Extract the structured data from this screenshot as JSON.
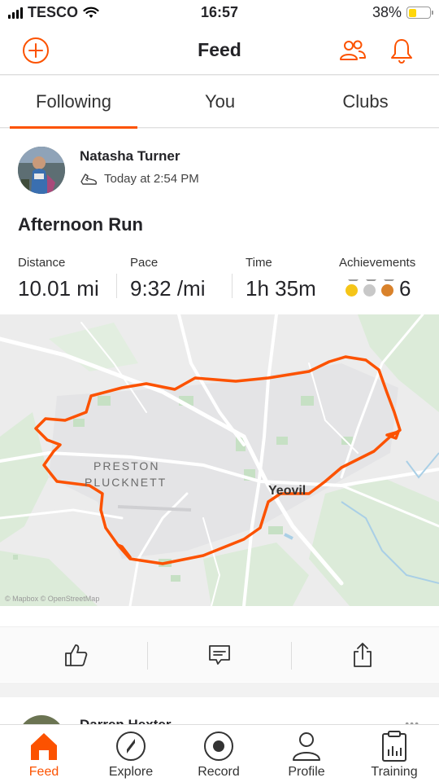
{
  "status_bar": {
    "carrier": "TESCO",
    "time": "16:57",
    "battery_percent": "38%",
    "battery_level": 0.38,
    "icons": [
      "signal-icon",
      "wifi-icon",
      "battery-icon"
    ]
  },
  "header": {
    "title": "Feed",
    "icons": [
      "add-icon",
      "people-icon",
      "bell-icon"
    ]
  },
  "tabs": [
    {
      "label": "Following",
      "active": true
    },
    {
      "label": "You",
      "active": false
    },
    {
      "label": "Clubs",
      "active": false
    }
  ],
  "activity": {
    "athlete": "Natasha Turner",
    "timestamp": "Today at 2:54 PM",
    "sport_icon": "shoe-icon",
    "title": "Afternoon Run",
    "stats": {
      "distance": {
        "label": "Distance",
        "value": "10.01 mi"
      },
      "pace": {
        "label": "Pace",
        "value": "9:32 /mi"
      },
      "time": {
        "label": "Time",
        "value": "1h 35m"
      },
      "achievements": {
        "label": "Achievements",
        "value": "6",
        "medals": [
          "gold",
          "silver",
          "bronze"
        ]
      }
    },
    "map": {
      "places": [
        "PRESTON",
        "PLUCKNETT",
        "Yeovil"
      ],
      "attribution": "© Mapbox © OpenStreetMap",
      "route_color": "#fc5200"
    },
    "actions": [
      "kudos-icon",
      "comment-icon",
      "share-icon"
    ]
  },
  "next_activity": {
    "athlete": "Darren Hexter",
    "more": "•••"
  },
  "bottom_nav": [
    {
      "label": "Feed",
      "icon": "home-icon",
      "active": true
    },
    {
      "label": "Explore",
      "icon": "compass-icon",
      "active": false
    },
    {
      "label": "Record",
      "icon": "record-icon",
      "active": false
    },
    {
      "label": "Profile",
      "icon": "profile-icon",
      "active": false
    },
    {
      "label": "Training",
      "icon": "training-icon",
      "active": false
    }
  ],
  "colors": {
    "accent": "#fc5200",
    "gold": "#f5c518",
    "silver": "#c8c8c8",
    "bronze": "#d9822b"
  }
}
